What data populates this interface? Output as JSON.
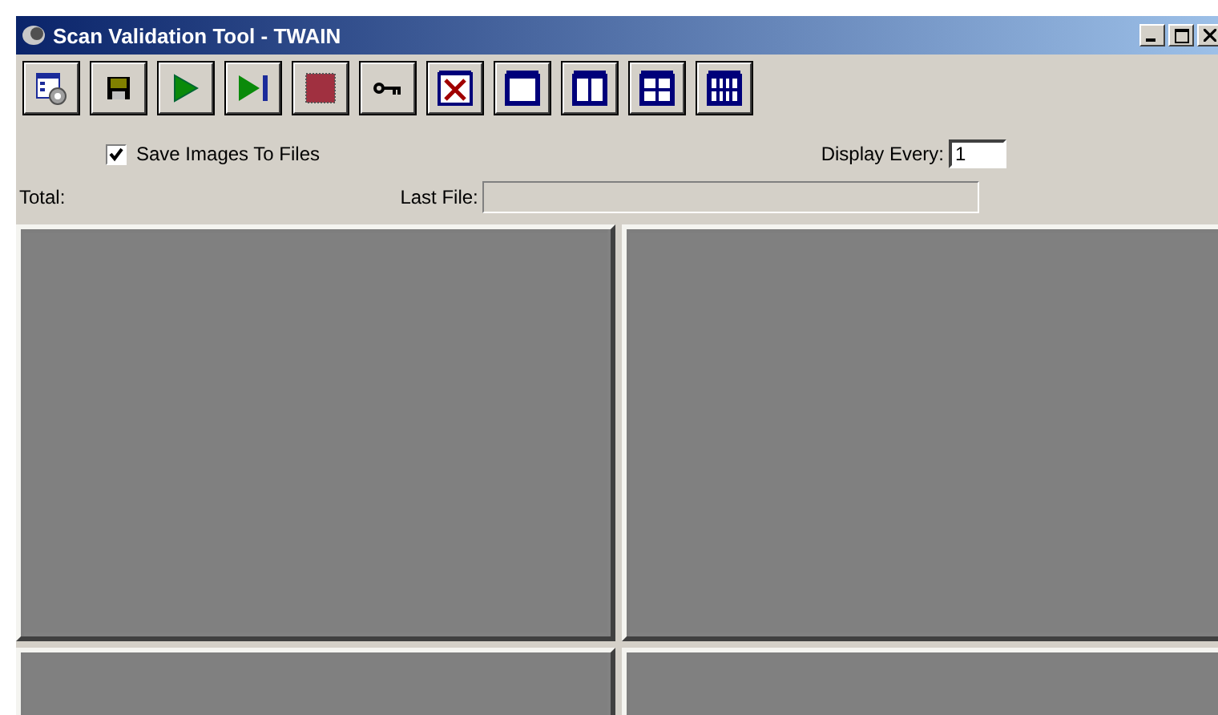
{
  "window": {
    "title": "Scan Validation Tool - TWAIN"
  },
  "toolbar": [
    {
      "kind": "settings"
    },
    {
      "kind": "save"
    },
    {
      "kind": "play"
    },
    {
      "kind": "step"
    },
    {
      "kind": "stop"
    },
    {
      "kind": "key"
    },
    {
      "kind": "no-view"
    },
    {
      "kind": "view-1"
    },
    {
      "kind": "view-2"
    },
    {
      "kind": "view-4"
    },
    {
      "kind": "view-8"
    }
  ],
  "options": {
    "save_images": {
      "label": "Save Images To Files",
      "checked": true
    },
    "display_every": {
      "label": "Display Every:",
      "value": "1"
    }
  },
  "status": {
    "total_label": "Total:",
    "last_file_label": "Last File:"
  }
}
